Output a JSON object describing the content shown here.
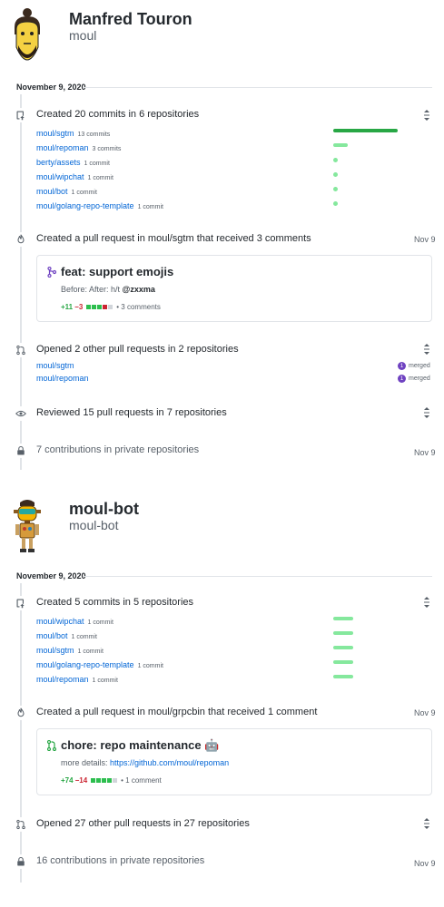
{
  "users": [
    {
      "name": "Manfred Touron",
      "login": "moul",
      "date_header": "November 9, 2020",
      "commits": {
        "summary": "Created 20 commits in 6 repositories",
        "repos": [
          {
            "name": "moul/sgtm",
            "count": "13 commits",
            "share": 1.0
          },
          {
            "name": "moul/repoman",
            "count": "3 commits",
            "share": 0.23
          },
          {
            "name": "berty/assets",
            "count": "1 commit",
            "share": 0.0
          },
          {
            "name": "moul/wipchat",
            "count": "1 commit",
            "share": 0.0
          },
          {
            "name": "moul/bot",
            "count": "1 commit",
            "share": 0.0
          },
          {
            "name": "moul/golang-repo-template",
            "count": "1 commit",
            "share": 0.0
          }
        ]
      },
      "pr": {
        "summary": "Created a pull request in moul/sgtm that received 3 comments",
        "date": "Nov 9",
        "title": "feat: support emojis",
        "body_prefix": "Before: After: h/t ",
        "body_mention": "@zxxma",
        "additions": "+11",
        "deletions": "−3",
        "comments": "• 3 comments"
      },
      "other_prs": {
        "summary": "Opened 2 other pull requests in 2 repositories",
        "repos": [
          {
            "name": "moul/sgtm",
            "badge_count": "1",
            "badge_label": "merged"
          },
          {
            "name": "moul/repoman",
            "badge_count": "1",
            "badge_label": "merged"
          }
        ]
      },
      "reviews": {
        "summary": "Reviewed 15 pull requests in 7 repositories"
      },
      "private": {
        "summary": "7 contributions in private repositories",
        "date": "Nov 9"
      }
    },
    {
      "name": "moul-bot",
      "login": "moul-bot",
      "date_header": "November 9, 2020",
      "commits": {
        "summary": "Created 5 commits in 5 repositories",
        "repos": [
          {
            "name": "moul/wipchat",
            "count": "1 commit",
            "share": 0.3
          },
          {
            "name": "moul/bot",
            "count": "1 commit",
            "share": 0.3
          },
          {
            "name": "moul/sgtm",
            "count": "1 commit",
            "share": 0.3
          },
          {
            "name": "moul/golang-repo-template",
            "count": "1 commit",
            "share": 0.3
          },
          {
            "name": "moul/repoman",
            "count": "1 commit",
            "share": 0.3
          }
        ]
      },
      "pr": {
        "summary": "Created a pull request in moul/grpcbin that received 1 comment",
        "date": "Nov 9",
        "title": "chore: repo maintenance 🤖",
        "body_prefix": "more details: ",
        "body_link": "https://github.com/moul/repoman",
        "additions": "+74",
        "deletions": "−14",
        "comments": "• 1 comment"
      },
      "other_prs": {
        "summary": "Opened 27 other pull requests in 27 repositories"
      },
      "private": {
        "summary": "16 contributions in private repositories",
        "date": "Nov 9"
      }
    }
  ],
  "colors": {
    "link": "#0366d6",
    "bar_light": "#85e89d",
    "bar_dark": "#28a745",
    "merged": "#6f42c1",
    "timeline": "#e1e4e8"
  },
  "icons": [
    "repo-push-icon",
    "flame-icon",
    "pull-request-icon",
    "eye-icon",
    "lock-icon",
    "fold-icon",
    "merged-icon",
    "avatar-manfred",
    "avatar-moul-bot"
  ]
}
